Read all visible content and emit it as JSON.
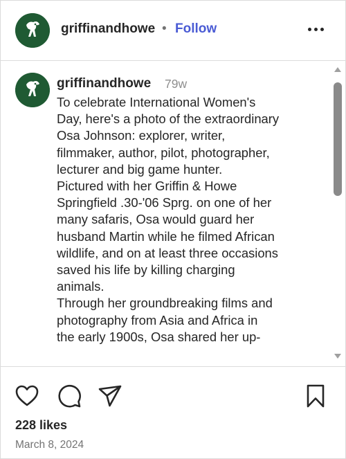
{
  "header": {
    "username": "griffinandhowe",
    "separator": "•",
    "follow_label": "Follow",
    "more_icon": "more-options-icon"
  },
  "caption": {
    "username": "griffinandhowe",
    "time": "79w",
    "text": "To celebrate International Women's\nDay, here's a photo of the extraordinary\nOsa Johnson: explorer, writer,\nfilmmaker, author, pilot, photographer,\nlecturer and big game hunter.\nPictured with her Griffin & Howe\nSpringfield .30-'06 Sprg. on one of her\nmany safaris, Osa would guard her\nhusband Martin while he filmed African\nwildlife, and on at least three occasions\nsaved his life by killing charging\nanimals.\nThrough her groundbreaking films and\nphotography from Asia and Africa in\nthe early 1900s, Osa shared her up-"
  },
  "actions": {
    "like_icon": "heart-icon",
    "comment_icon": "comment-icon",
    "share_icon": "send-icon",
    "save_icon": "bookmark-icon",
    "likes": "228 likes",
    "date": "March 8, 2024"
  },
  "colors": {
    "follow": "#4a5bd4",
    "avatar_bg": "#1f5a33",
    "secondary_text": "#737373"
  }
}
